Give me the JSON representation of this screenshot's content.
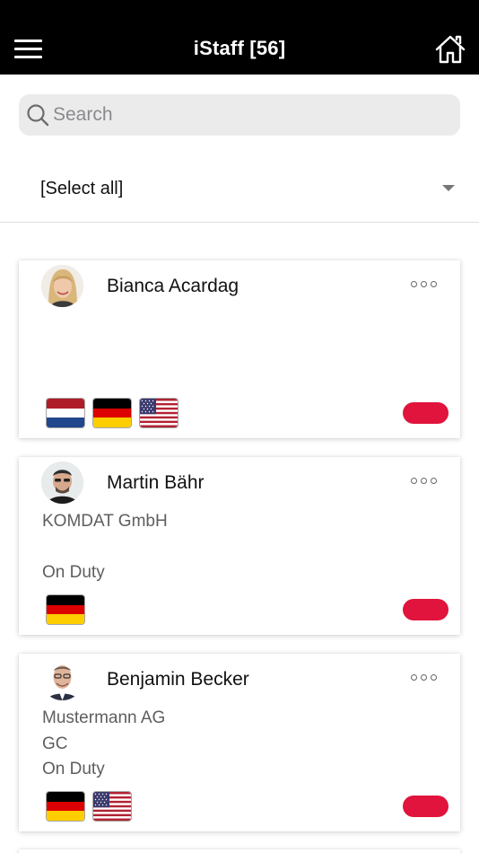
{
  "header": {
    "title": "iStaff [56]",
    "menu_icon": "hamburger-menu-icon",
    "home_icon": "home-icon",
    "background": "#000000"
  },
  "search": {
    "placeholder": "Search",
    "value": "",
    "icon": "search-icon"
  },
  "filter": {
    "selected": "[Select all]",
    "icon": "dropdown-arrow-icon"
  },
  "staff": [
    {
      "name": "Bianca Acardag",
      "company": "",
      "role": "",
      "status": "",
      "flags": [
        "netherlands-flag-icon",
        "germany-flag-icon",
        "usa-flag-icon"
      ],
      "status_color": "#e0143c"
    },
    {
      "name": "Martin Bähr",
      "company": "KOMDAT GmbH",
      "role": "",
      "status": "On Duty",
      "flags": [
        "germany-flag-icon"
      ],
      "status_color": "#e0143c"
    },
    {
      "name": "Benjamin Becker",
      "company": "Mustermann AG",
      "role": "GC",
      "status": "On Duty",
      "flags": [
        "germany-flag-icon",
        "usa-flag-icon"
      ],
      "status_color": "#e0143c"
    }
  ],
  "colors": {
    "accent": "#e0143c",
    "search_background": "#ebebeb"
  }
}
